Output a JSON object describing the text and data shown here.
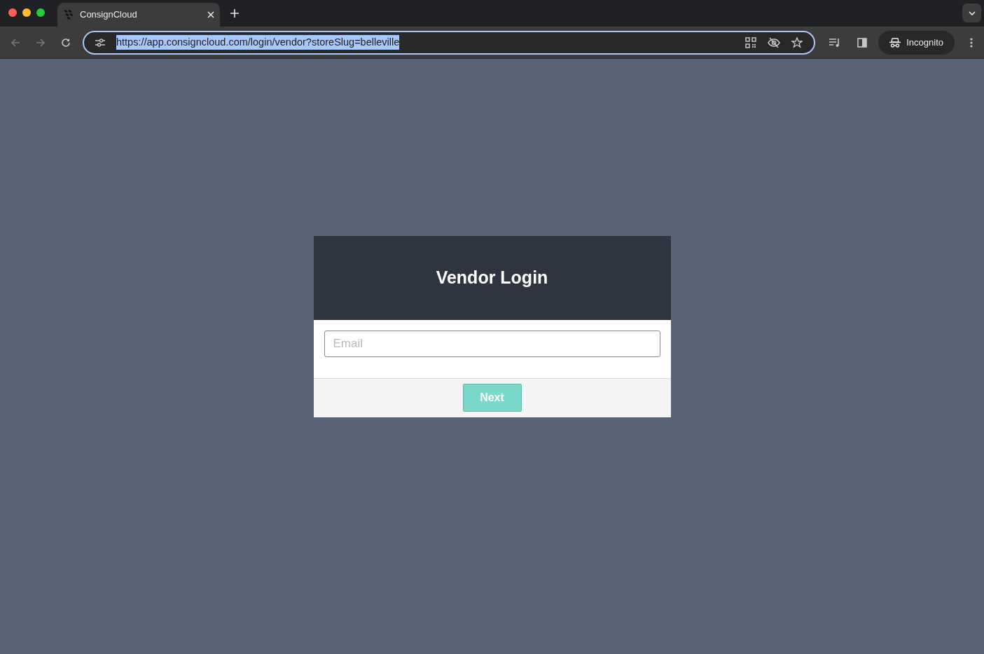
{
  "browser": {
    "tab_title": "ConsignCloud",
    "url": "https://app.consigncloud.com/login/vendor?storeSlug=belleville",
    "url_selected": true,
    "profile_label": "Incognito"
  },
  "login": {
    "title": "Vendor Login",
    "email": {
      "placeholder": "Email"
    },
    "next_button": "Next"
  }
}
